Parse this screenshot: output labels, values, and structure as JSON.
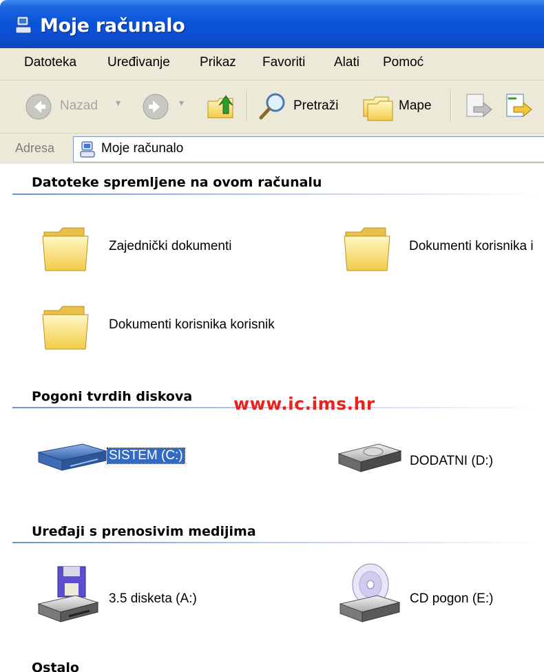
{
  "window": {
    "title": "Moje računalo"
  },
  "menu": [
    "Datoteka",
    "Uređivanje",
    "Prikaz",
    "Favoriti",
    "Alati",
    "Pomoć"
  ],
  "toolbar": {
    "back_label": "Nazad",
    "search_label": "Pretraži",
    "folders_label": "Mape"
  },
  "address": {
    "label": "Adresa",
    "value": "Moje računalo"
  },
  "groups": {
    "files": {
      "title": "Datoteke spremljene na ovom računalu",
      "items": [
        "Zajednički dokumenti",
        "Dokumenti korisnika i",
        "Dokumenti korisnika korisnik"
      ]
    },
    "hard_drives": {
      "title": "Pogoni tvrdih diskova",
      "items": [
        "SISTEM (C:)",
        "DODATNI (D:)"
      ]
    },
    "removable": {
      "title": "Uređaji s prenosivim medijima",
      "items": [
        "3.5 disketa (A:)",
        "CD pogon (E:)"
      ]
    },
    "other": {
      "title": "Ostalo"
    }
  },
  "watermark": "www.ic.ims.hr",
  "colors": {
    "titlebar": "#0a55d9",
    "selection": "#316ac5",
    "watermark": "#e8231d"
  }
}
